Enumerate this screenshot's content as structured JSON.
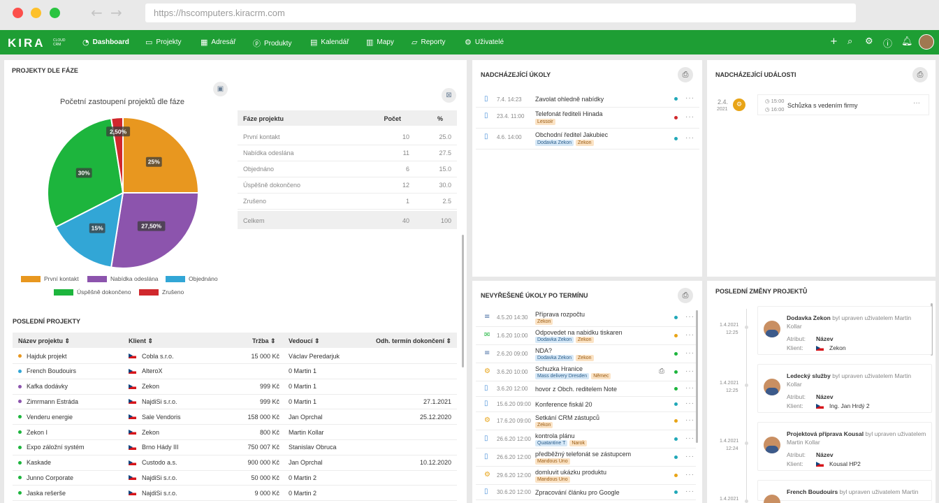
{
  "browser": {
    "url": "https://hscomputers.kiracrm.com"
  },
  "nav": {
    "logo": "KIRA",
    "logo_sub1": "CLOUD",
    "logo_sub2": "CRM",
    "items": [
      {
        "label": "Dashboard",
        "icon": "dashboard-icon"
      },
      {
        "label": "Projekty",
        "icon": "briefcase-icon"
      },
      {
        "label": "Adresář",
        "icon": "address-book-icon"
      },
      {
        "label": "Produkty",
        "icon": "product-icon"
      },
      {
        "label": "Kalendář",
        "icon": "calendar-icon"
      },
      {
        "label": "Mapy",
        "icon": "map-icon"
      },
      {
        "label": "Reporty",
        "icon": "report-icon"
      },
      {
        "label": "Uživatelé",
        "icon": "users-icon"
      }
    ]
  },
  "phases": {
    "title": "PROJEKTY DLE FÁZE",
    "chart_title": "Početní zastoupení projektů dle fáze",
    "table_head": [
      "Fáze projektu",
      "Počet",
      "%"
    ],
    "rows": [
      [
        "První kontakt",
        "10",
        "25.0"
      ],
      [
        "Nabídka odeslána",
        "11",
        "27.5"
      ],
      [
        "Objednáno",
        "6",
        "15.0"
      ],
      [
        "Úspěšně dokončeno",
        "12",
        "30.0"
      ],
      [
        "Zrušeno",
        "1",
        "2.5"
      ]
    ],
    "total": [
      "Celkem",
      "40",
      "100"
    ],
    "labels": [
      "25%",
      "27,50%",
      "15%",
      "30%",
      "2,50%"
    ]
  },
  "chart_data": {
    "type": "pie",
    "title": "Početní zastoupení projektů dle fáze",
    "categories": [
      "První kontakt",
      "Nabídka odeslána",
      "Objednáno",
      "Úspěšně dokončeno",
      "Zrušeno"
    ],
    "values": [
      25,
      27.5,
      15,
      30,
      2.5
    ],
    "colors": [
      "#e8971f",
      "#8c54ad",
      "#32a6d6",
      "#1db53d",
      "#d0282d"
    ],
    "legend": "bottom"
  },
  "recent": {
    "title": "POSLEDNÍ PROJEKTY",
    "head": [
      "Název projektu",
      "Klient",
      "Tržba",
      "Vedoucí",
      "Odh. termín dokončení"
    ],
    "rows": [
      {
        "n": "Hajduk projekt",
        "c": "Cobla s.r.o.",
        "t": "15 000 Kč",
        "v": "Václav Peredarjuk",
        "d": "",
        "col": "#e8971f"
      },
      {
        "n": "French Boudouirs",
        "c": "AlteroX",
        "t": "",
        "v": "0 Martin 1",
        "d": "",
        "col": "#32a6d6"
      },
      {
        "n": "Kafka dodávky",
        "c": "Zekon",
        "t": "999 Kč",
        "v": "0 Martin 1",
        "d": "",
        "col": "#8c54ad"
      },
      {
        "n": "Zimrmann Estráda",
        "c": "NajdiSi s.r.o.",
        "t": "999 Kč",
        "v": "0 Martin 1",
        "d": "27.1.2021",
        "col": "#8c54ad"
      },
      {
        "n": "Venderu energie",
        "c": "Sale Vendoris",
        "t": "158 000 Kč",
        "v": "Jan Oprchal",
        "d": "25.12.2020",
        "col": "#1db53d"
      },
      {
        "n": "Zekon I",
        "c": "Zekon",
        "t": "800 Kč",
        "v": "Martin Kollar",
        "d": "",
        "col": "#1db53d"
      },
      {
        "n": "Expo záložní systém",
        "c": "Brno Hády III",
        "t": "750 007 Kč",
        "v": "Stanislav Obruca",
        "d": "",
        "col": "#1db53d"
      },
      {
        "n": "Kaskade",
        "c": "Custodo a.s.",
        "t": "900 000 Kč",
        "v": "Jan Oprchal",
        "d": "10.12.2020",
        "col": "#1db53d"
      },
      {
        "n": "Junno Corporate",
        "c": "NajdiSi s.r.o.",
        "t": "50 000 Kč",
        "v": "0 Martin 2",
        "d": "",
        "col": "#1db53d"
      },
      {
        "n": "Jaska rešerše",
        "c": "NajdiSi s.r.o.",
        "t": "9 000 Kč",
        "v": "0 Martin 2",
        "d": "",
        "col": "#1db53d"
      }
    ]
  },
  "upcoming_tasks": {
    "title": "NADCHÁZEJÍCÍ ÚKOLY",
    "items": [
      {
        "dt": "7.4. 14:23",
        "t": "Zavolat ohledně nabídky",
        "tags": [],
        "st": "#21a8b8"
      },
      {
        "dt": "23.4. 11:00",
        "t": "Telefonát řediteli Hinada",
        "tags": [
          [
            "Lessoir",
            "or"
          ]
        ],
        "st": "#d0282d"
      },
      {
        "dt": "4.6. 14:00",
        "t": "Obchodní ředitel Jakubiec",
        "tags": [
          [
            "Dodavka Zekon",
            "blue"
          ],
          [
            "Zekon",
            "or"
          ]
        ],
        "st": "#21a8b8"
      }
    ]
  },
  "upcoming_events": {
    "title": "NADCHÁZEJÍCÍ UDÁLOSTI",
    "day": "2.4.",
    "year": "2021",
    "from": "15:00",
    "to": "16:00",
    "t": "Schůzka s vedením firmy"
  },
  "overdue": {
    "title": "NEVYŘEŠENÉ ÚKOLY PO TERMÍNU",
    "items": [
      {
        "i": "≡",
        "dt": "4.5.20 14:30",
        "t": "Příprava rozpočtu",
        "tags": [
          [
            "Zekon",
            "or"
          ]
        ],
        "st": "#21a8b8"
      },
      {
        "i": "✉",
        "dt": "1.6.20 10:00",
        "t": "Odpovedet na nabidku tiskaren",
        "tags": [
          [
            "Dodavka Zekon",
            "blue"
          ],
          [
            "Zekon",
            "or"
          ]
        ],
        "st": "#e8a417"
      },
      {
        "i": "≡",
        "dt": "2.6.20 09:00",
        "t": "NDA?",
        "tags": [
          [
            "Dodavka Zekon",
            "blue"
          ],
          [
            "Zekon",
            "or"
          ]
        ],
        "st": "#1db53d"
      },
      {
        "i": "⚙",
        "dt": "3.6.20 10:00",
        "t": "Schuzka Hranice",
        "tags": [
          [
            "Mass delivery Dresden",
            "blue"
          ],
          [
            "Němec",
            "or"
          ]
        ],
        "st": "#1db53d"
      },
      {
        "i": "▯",
        "dt": "3.6.20 12:00",
        "t": "hovor z Obch. reditelem Note",
        "tags": [],
        "st": "#1db53d"
      },
      {
        "i": "▯",
        "dt": "15.6.20 09:00",
        "t": "Konference fiskál 20",
        "tags": [],
        "st": "#21a8b8"
      },
      {
        "i": "⚙",
        "dt": "17.6.20 09:00",
        "t": "Setkání CRM zástupců",
        "tags": [
          [
            "Zekon",
            "or"
          ]
        ],
        "st": "#e8a417"
      },
      {
        "i": "▯",
        "dt": "26.6.20 12:00",
        "t": "kontrola plánu",
        "tags": [
          [
            "Quatantine T",
            "blue"
          ],
          [
            "Narok",
            "or"
          ]
        ],
        "st": "#21a8b8"
      },
      {
        "i": "▯",
        "dt": "26.6.20 12:00",
        "t": "předběžný telefonát se zástupcem",
        "tags": [
          [
            "Mandous Uno",
            "or"
          ]
        ],
        "st": "#21a8b8"
      },
      {
        "i": "⚙",
        "dt": "29.6.20 12:00",
        "t": "domluvit ukázku produktu",
        "tags": [
          [
            "Mandous Uno",
            "or"
          ]
        ],
        "st": "#e8a417"
      },
      {
        "i": "▯",
        "dt": "30.6.20 12:00",
        "t": "Zpracování článku pro Google",
        "tags": [],
        "st": "#21a8b8"
      }
    ]
  },
  "changes": {
    "title": "POSLEDNÍ ZMĚNY PROJEKTŮ",
    "attr_label": "Atribut:",
    "client_label": "Klient:",
    "items": [
      {
        "d": "1.4.2021",
        "tm": "12:25",
        "p": "Dodavka Zekon",
        "txt": " byl upraven uživatelem Martin Kollar",
        "a": "Název",
        "c": "Zekon"
      },
      {
        "d": "1.4.2021",
        "tm": "12:25",
        "p": "Ledecký služby",
        "txt": " byl upraven uživatelem Martin Kollar",
        "a": "Název",
        "c": "Ing. Jan Hrdý 2"
      },
      {
        "d": "1.4.2021",
        "tm": "12:24",
        "p": "Projektová příprava Kousal",
        "txt": " byl upraven uživatelem Martin Kollar",
        "a": "Název",
        "c": "Kousal HP2"
      },
      {
        "d": "1.4.2021",
        "tm": "",
        "p": "French Boudouirs",
        "txt": " byl upraven uživatelem Martin",
        "a": "",
        "c": ""
      }
    ]
  }
}
